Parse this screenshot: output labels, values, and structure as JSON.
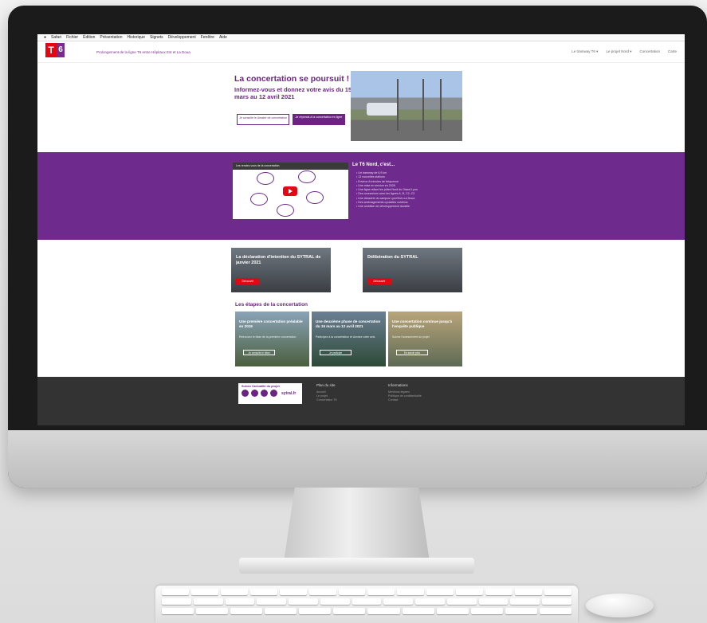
{
  "menubar": [
    "Safari",
    "Fichier",
    "Édition",
    "Présentation",
    "Historique",
    "Signets",
    "Développement",
    "Fenêtre",
    "Aide"
  ],
  "header": {
    "logo_t": "T",
    "logo_6": "6",
    "tagline": "Prolongement de la ligne T6 entre Hôpitaux Est et La Doua",
    "links": [
      "Le tramway T6 ▾",
      "Le projet Nord ▾",
      "Concertation",
      "Carte"
    ]
  },
  "hero": {
    "title": "La concertation se poursuit !",
    "subtitle": "Informez-vous et donnez votre avis du 15 mars au 12 avril 2021",
    "btn1": "Je consulte le dossier de concertation",
    "btn2": "Je réponds à la concertation en ligne"
  },
  "band": {
    "video_title": "Les rendez-vous de la concertation",
    "heading": "Le T6 Nord, c'est...",
    "facts": [
      "• Un tramway de 6,9 km",
      "• 13 nouvelles stations",
      "• Environ 8 minutes de fréquence",
      "• Une mise en service en 2026",
      "• Une ligne reliant les pôles Nord du Grand Lyon",
      "• Des connexions avec les lignes A, B, C2, C3",
      "• Une desserte du campus LyonTech-La Doua",
      "• Des aménagements cyclables continus",
      "• Une ambition de développement durable"
    ]
  },
  "cards": [
    {
      "title": "La déclaration d'intention du SYTRAL de janvier 2021",
      "btn": "Découvrir"
    },
    {
      "title": "Délibération du SYTRAL",
      "btn": "Découvrir"
    }
  ],
  "steps": {
    "title": "Les étapes de la concertation",
    "items": [
      {
        "title": "Une première concertation préalable en 2019",
        "desc": "Retrouvez le bilan de la première concertation",
        "btn": "Je consulte le bilan"
      },
      {
        "title": "Une deuxième phase de concertation du 15 mars au 12 avril 2021",
        "desc": "Participez à la concertation et donnez votre avis",
        "btn": "Je participe"
      },
      {
        "title": "Une concertation continue jusqu'à l'enquête publique",
        "desc": "Suivez l'avancement du projet",
        "btn": "En savoir plus"
      }
    ]
  },
  "footer": {
    "follow": "Suivez l'actualité du projet",
    "brand": "sytral.fr",
    "col1_title": "Plan du site",
    "col1_items": [
      "Accueil",
      "Le projet",
      "Concertation T6"
    ],
    "col2_title": "Informations",
    "col2_items": [
      "Mentions légales",
      "Politique de confidentialité",
      "Contact"
    ]
  }
}
